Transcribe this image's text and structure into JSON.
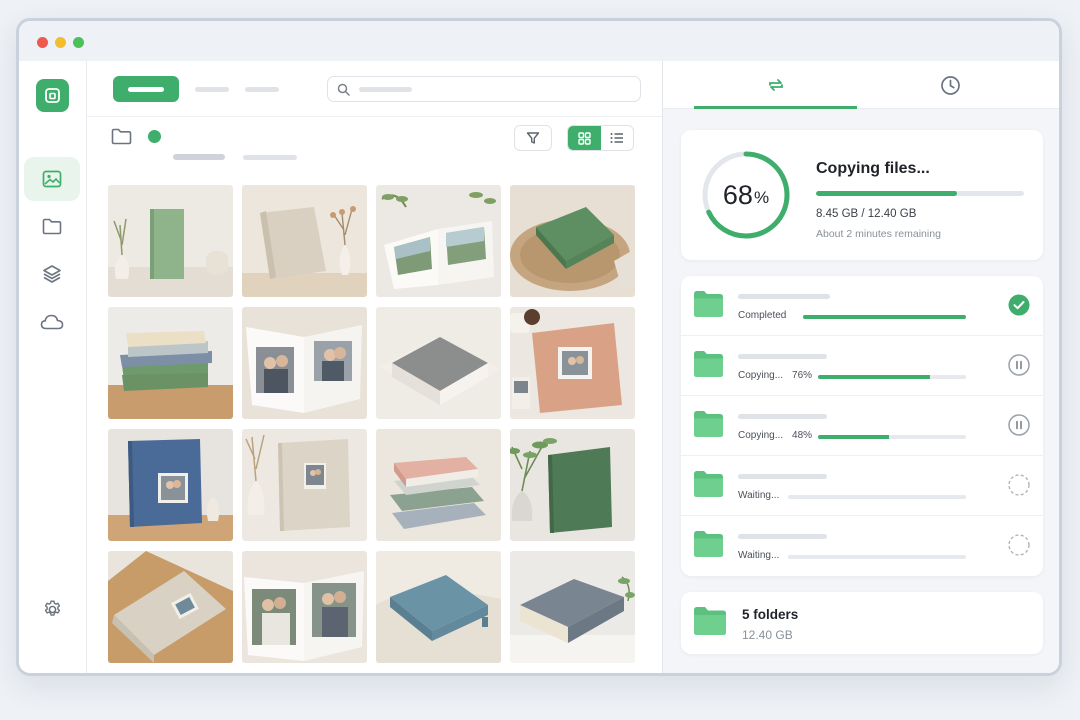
{
  "window": {
    "controls": [
      "close",
      "minimize",
      "maximize"
    ]
  },
  "sidebar": {
    "logo_icon": "app-logo-icon",
    "items": [
      {
        "name": "photos",
        "icon": "image-icon",
        "active": true
      },
      {
        "name": "folders",
        "icon": "folder-icon",
        "active": false
      },
      {
        "name": "layers",
        "icon": "layers-icon",
        "active": false
      },
      {
        "name": "cloud",
        "icon": "cloud-icon",
        "active": false
      }
    ],
    "settings_icon": "gear-icon"
  },
  "toolbar": {
    "view_mode": "grid"
  },
  "gallery": {
    "thumbnails": [
      "green album with vase",
      "linen album with dried flowers",
      "open album landscape photos",
      "green album box on rattan",
      "stack of albums",
      "open wedding album",
      "grey album in box",
      "pink album with couple photo",
      "blue album with couple photo",
      "linen album with photo window",
      "stacked pastel albums",
      "green album with eucalyptus",
      "linen album in kraft box",
      "open album couple spread",
      "blue album box on linen",
      "grey hardcover album"
    ]
  },
  "right_panel": {
    "tabs": [
      {
        "name": "sync",
        "icon": "sync-icon",
        "active": true
      },
      {
        "name": "history",
        "icon": "clock-icon",
        "active": false
      }
    ],
    "progress": {
      "percent_number": "68",
      "percent_sign": "%",
      "fraction": 0.68,
      "title": "Copying files...",
      "sizes": "8.45 GB / 12.40 GB",
      "remaining": "About 2 minutes remaining"
    },
    "transfers": [
      {
        "status": "Completed",
        "percent_text": "",
        "fraction": 1.0,
        "state": "done",
        "icon": "check-circle-icon"
      },
      {
        "status": "Copying...",
        "percent_text": "76%",
        "fraction": 0.76,
        "state": "active",
        "icon": "pause-icon"
      },
      {
        "status": "Copying...",
        "percent_text": "48%",
        "fraction": 0.48,
        "state": "active",
        "icon": "pause-icon"
      },
      {
        "status": "Waiting...",
        "percent_text": "",
        "fraction": 0,
        "state": "waiting",
        "icon": "pending-icon"
      },
      {
        "status": "Waiting...",
        "percent_text": "",
        "fraction": 0,
        "state": "waiting",
        "icon": "pending-icon"
      }
    ],
    "summary": {
      "title": "5 folders",
      "size": "12.40 GB"
    }
  },
  "colors": {
    "accent": "#3fae6c",
    "folder": "#5cc17f",
    "track": "#e3e7ec"
  }
}
